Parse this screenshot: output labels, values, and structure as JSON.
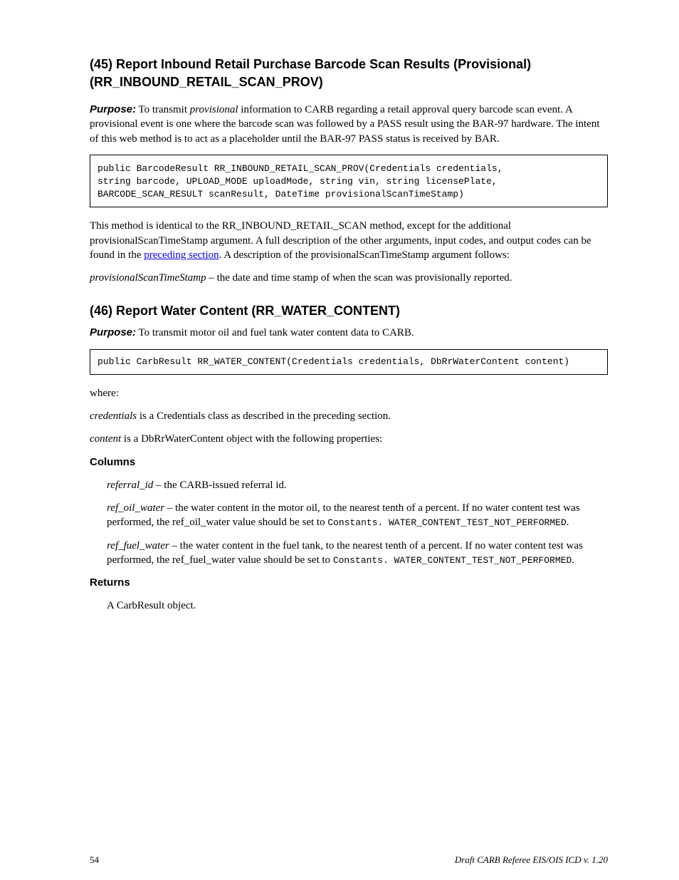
{
  "headings": {
    "main": "(45) Report Inbound Retail Purchase Barcode Scan Results (Provisional)",
    "sub": "(RR_INBOUND_RETAIL_SCAN_PROV)",
    "section2": "(46) Report Water Content (RR_WATER_CONTENT)"
  },
  "purpose": {
    "label": "Purpose:",
    "text_before_italic": " To transmit ",
    "italic": "provisional",
    "text_after_italic": " information to CARB regarding a retail approval query barcode scan event. A provisional event is one where the barcode scan was followed by a PASS result using the BAR-97 hardware. The intent of this web method is to act as a placeholder until the BAR-97 PASS status is received by BAR."
  },
  "code1": {
    "line1": "public BarcodeResult RR_INBOUND_RETAIL_SCAN_PROV(Credentials credentials,",
    "line2": "string barcode, UPLOAD_MODE uploadMode, string vin, string licensePlate,",
    "line3": "BARCODE_SCAN_RESULT scanResult, DateTime provisionalScanTimeStamp)"
  },
  "paragraphs": {
    "p1_before_link": "This method is identical to the RR_INBOUND_RETAIL_SCAN method, except for the additional provisionalScanTimeStamp argument. A full description of the other arguments, input codes, and output codes can be found in the ",
    "link_text": "preceding section",
    "p1_after_link": ". A description of the provisionalScanTimeStamp argument follows:",
    "p2_label": "provisionalScanTimeStamp",
    "p2_text": " – the date and time stamp of when the scan was provisionally reported."
  },
  "purpose2": {
    "label": "Purpose:",
    "text": " To transmit motor oil and fuel tank water content data to CARB."
  },
  "code2": "public CarbResult RR_WATER_CONTENT(Credentials credentials, DbRrWaterContent content)",
  "paragraphs2": {
    "lead": "where:",
    "item1_label": "credentials",
    "item1_text": " is a Credentials class as described in the preceding section.",
    "item2_label": "content",
    "item2_text": " is a DbRrWaterContent object with the following properties:",
    "columns_label": "Columns",
    "prop1_label": "referral_id",
    "prop1_text": " – the CARB-issued referral id.",
    "prop2_label": "ref_oil_water",
    "prop2_text": " – the water content in the motor oil, to the nearest tenth of a percent. If no water content test was performed, the ref_oil_water value should be set to ",
    "prop2_code": "Constants. WATER_CONTENT_TEST_NOT_PERFORMED",
    "prop2_tail": ".",
    "prop3_label": "ref_fuel_water",
    "prop3_text": " – the water content in the fuel tank, to the nearest tenth of a percent. If no water content test was performed, the ref_fuel_water value should be set to ",
    "prop3_code": "Constants. WATER_CONTENT_TEST_NOT_PERFORMED",
    "prop3_tail": "."
  },
  "returns": {
    "label": "Returns",
    "text": "A CarbResult object."
  },
  "footer": {
    "page": "54",
    "doc": "Draft CARB Referee EIS/OIS ICD v. 1.20"
  }
}
